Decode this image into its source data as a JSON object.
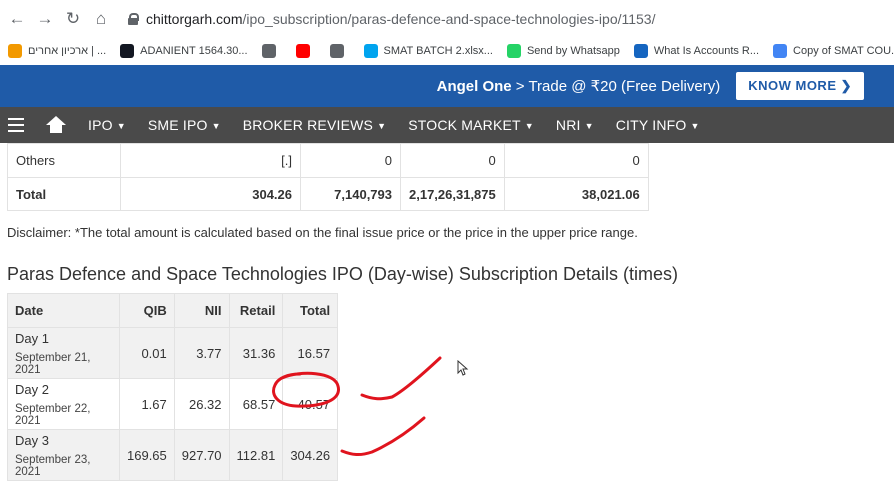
{
  "browser": {
    "url_domain": "chittorgarh.com",
    "url_path": "/ipo_subscription/paras-defence-and-space-technologies-ipo/1153/",
    "bookmarks": [
      {
        "label": "ארכיון אחרים | ...",
        "icon": "bookmark-icon",
        "color": "#f29900"
      },
      {
        "label": "ADANIENT 1564.30...",
        "icon": "tradingview-icon",
        "color": "#131722"
      },
      {
        "label": "",
        "icon": "globe-icon",
        "color": "#5f6368"
      },
      {
        "label": "",
        "icon": "youtube-icon",
        "color": "#ff0000"
      },
      {
        "label": "",
        "icon": "globe-icon",
        "color": "#5f6368"
      },
      {
        "label": "SMAT BATCH 2.xlsx...",
        "icon": "microsoft-icon",
        "color": "#00a4ef"
      },
      {
        "label": "Send by Whatsapp",
        "icon": "whatsapp-icon",
        "color": "#25d366"
      },
      {
        "label": "What Is Accounts R...",
        "icon": "f-icon",
        "color": "#1565c0"
      },
      {
        "label": "Copy of SMAT COU...",
        "icon": "copy-icon",
        "color": "#4285f4"
      }
    ]
  },
  "banner": {
    "brand": "Angel One",
    "text": " > Trade @ ₹20 (Free Delivery)",
    "cta": "KNOW MORE ❯",
    "color": "#1f5ba8"
  },
  "menu": {
    "items": [
      "IPO",
      "SME IPO",
      "BROKER REVIEWS",
      "STOCK MARKET",
      "NRI",
      "CITY INFO"
    ]
  },
  "subscription_table": {
    "rows": [
      {
        "category": "Others",
        "c1": "[.]",
        "c2": "0",
        "c3": "0",
        "c4": "0"
      },
      {
        "category": "Total",
        "c1": "304.26",
        "c2": "7,140,793",
        "c3": "2,17,26,31,875",
        "c4": "38,021.06"
      }
    ]
  },
  "disclaimer": "Disclaimer: *The total amount is calculated based on the final issue price or the price in the upper price range.",
  "section_title": "Paras Defence and Space Technologies IPO (Day-wise) Subscription Details (times)",
  "daywise": {
    "headers": [
      "Date",
      "QIB",
      "NII",
      "Retail",
      "Total"
    ],
    "rows": [
      {
        "day": "Day 1",
        "date": "September 21, 2021",
        "qib": "0.01",
        "nii": "3.77",
        "retail": "31.36",
        "total": "16.57"
      },
      {
        "day": "Day 2",
        "date": "September 22, 2021",
        "qib": "1.67",
        "nii": "26.32",
        "retail": "68.57",
        "total": "40.57"
      },
      {
        "day": "Day 3",
        "date": "September 23, 2021",
        "qib": "169.65",
        "nii": "927.70",
        "retail": "112.81",
        "total": "304.26"
      }
    ]
  },
  "annotation_color": "#e0141e"
}
